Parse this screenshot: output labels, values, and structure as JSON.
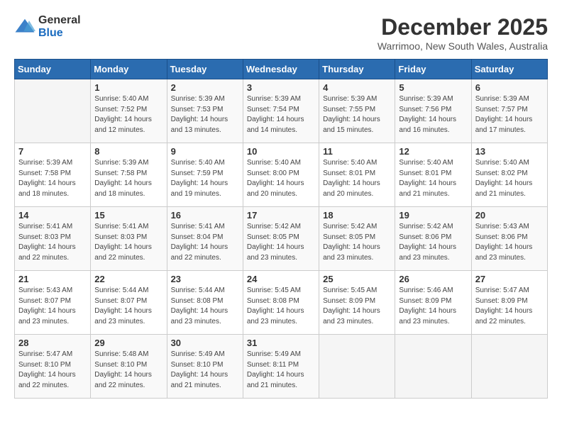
{
  "header": {
    "logo_general": "General",
    "logo_blue": "Blue",
    "month_title": "December 2025",
    "location": "Warrimoo, New South Wales, Australia"
  },
  "days_of_week": [
    "Sunday",
    "Monday",
    "Tuesday",
    "Wednesday",
    "Thursday",
    "Friday",
    "Saturday"
  ],
  "weeks": [
    [
      {
        "day": "",
        "content": ""
      },
      {
        "day": "1",
        "content": "Sunrise: 5:40 AM\nSunset: 7:52 PM\nDaylight: 14 hours\nand 12 minutes."
      },
      {
        "day": "2",
        "content": "Sunrise: 5:39 AM\nSunset: 7:53 PM\nDaylight: 14 hours\nand 13 minutes."
      },
      {
        "day": "3",
        "content": "Sunrise: 5:39 AM\nSunset: 7:54 PM\nDaylight: 14 hours\nand 14 minutes."
      },
      {
        "day": "4",
        "content": "Sunrise: 5:39 AM\nSunset: 7:55 PM\nDaylight: 14 hours\nand 15 minutes."
      },
      {
        "day": "5",
        "content": "Sunrise: 5:39 AM\nSunset: 7:56 PM\nDaylight: 14 hours\nand 16 minutes."
      },
      {
        "day": "6",
        "content": "Sunrise: 5:39 AM\nSunset: 7:57 PM\nDaylight: 14 hours\nand 17 minutes."
      }
    ],
    [
      {
        "day": "7",
        "content": "Sunrise: 5:39 AM\nSunset: 7:58 PM\nDaylight: 14 hours\nand 18 minutes."
      },
      {
        "day": "8",
        "content": "Sunrise: 5:39 AM\nSunset: 7:58 PM\nDaylight: 14 hours\nand 18 minutes."
      },
      {
        "day": "9",
        "content": "Sunrise: 5:40 AM\nSunset: 7:59 PM\nDaylight: 14 hours\nand 19 minutes."
      },
      {
        "day": "10",
        "content": "Sunrise: 5:40 AM\nSunset: 8:00 PM\nDaylight: 14 hours\nand 20 minutes."
      },
      {
        "day": "11",
        "content": "Sunrise: 5:40 AM\nSunset: 8:01 PM\nDaylight: 14 hours\nand 20 minutes."
      },
      {
        "day": "12",
        "content": "Sunrise: 5:40 AM\nSunset: 8:01 PM\nDaylight: 14 hours\nand 21 minutes."
      },
      {
        "day": "13",
        "content": "Sunrise: 5:40 AM\nSunset: 8:02 PM\nDaylight: 14 hours\nand 21 minutes."
      }
    ],
    [
      {
        "day": "14",
        "content": "Sunrise: 5:41 AM\nSunset: 8:03 PM\nDaylight: 14 hours\nand 22 minutes."
      },
      {
        "day": "15",
        "content": "Sunrise: 5:41 AM\nSunset: 8:03 PM\nDaylight: 14 hours\nand 22 minutes."
      },
      {
        "day": "16",
        "content": "Sunrise: 5:41 AM\nSunset: 8:04 PM\nDaylight: 14 hours\nand 22 minutes."
      },
      {
        "day": "17",
        "content": "Sunrise: 5:42 AM\nSunset: 8:05 PM\nDaylight: 14 hours\nand 23 minutes."
      },
      {
        "day": "18",
        "content": "Sunrise: 5:42 AM\nSunset: 8:05 PM\nDaylight: 14 hours\nand 23 minutes."
      },
      {
        "day": "19",
        "content": "Sunrise: 5:42 AM\nSunset: 8:06 PM\nDaylight: 14 hours\nand 23 minutes."
      },
      {
        "day": "20",
        "content": "Sunrise: 5:43 AM\nSunset: 8:06 PM\nDaylight: 14 hours\nand 23 minutes."
      }
    ],
    [
      {
        "day": "21",
        "content": "Sunrise: 5:43 AM\nSunset: 8:07 PM\nDaylight: 14 hours\nand 23 minutes."
      },
      {
        "day": "22",
        "content": "Sunrise: 5:44 AM\nSunset: 8:07 PM\nDaylight: 14 hours\nand 23 minutes."
      },
      {
        "day": "23",
        "content": "Sunrise: 5:44 AM\nSunset: 8:08 PM\nDaylight: 14 hours\nand 23 minutes."
      },
      {
        "day": "24",
        "content": "Sunrise: 5:45 AM\nSunset: 8:08 PM\nDaylight: 14 hours\nand 23 minutes."
      },
      {
        "day": "25",
        "content": "Sunrise: 5:45 AM\nSunset: 8:09 PM\nDaylight: 14 hours\nand 23 minutes."
      },
      {
        "day": "26",
        "content": "Sunrise: 5:46 AM\nSunset: 8:09 PM\nDaylight: 14 hours\nand 23 minutes."
      },
      {
        "day": "27",
        "content": "Sunrise: 5:47 AM\nSunset: 8:09 PM\nDaylight: 14 hours\nand 22 minutes."
      }
    ],
    [
      {
        "day": "28",
        "content": "Sunrise: 5:47 AM\nSunset: 8:10 PM\nDaylight: 14 hours\nand 22 minutes."
      },
      {
        "day": "29",
        "content": "Sunrise: 5:48 AM\nSunset: 8:10 PM\nDaylight: 14 hours\nand 22 minutes."
      },
      {
        "day": "30",
        "content": "Sunrise: 5:49 AM\nSunset: 8:10 PM\nDaylight: 14 hours\nand 21 minutes."
      },
      {
        "day": "31",
        "content": "Sunrise: 5:49 AM\nSunset: 8:11 PM\nDaylight: 14 hours\nand 21 minutes."
      },
      {
        "day": "",
        "content": ""
      },
      {
        "day": "",
        "content": ""
      },
      {
        "day": "",
        "content": ""
      }
    ]
  ]
}
